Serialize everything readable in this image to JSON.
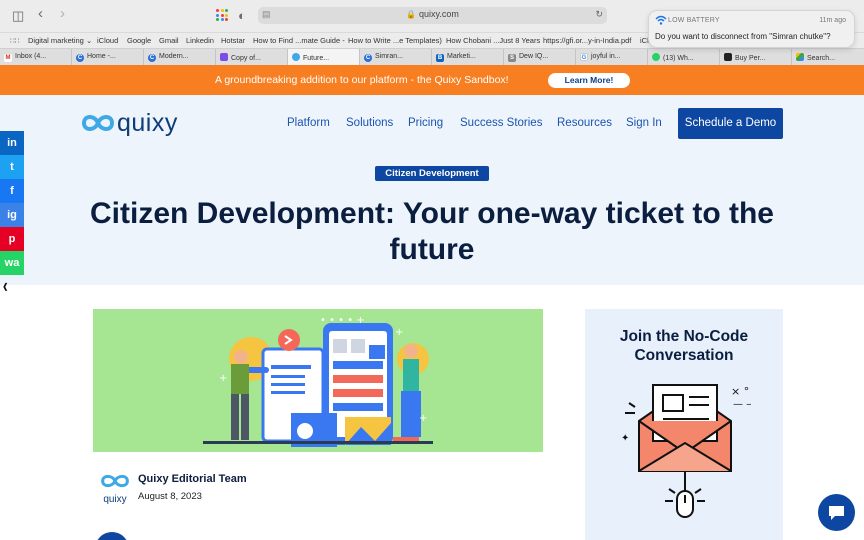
{
  "browser": {
    "url": "quixy.com",
    "bookmarks": [
      "Digital marketing ⌄",
      "iCloud",
      "Google",
      "Gmail",
      "Linkedin",
      "Hotstar",
      "How to Find ...mate Guide -",
      "How to Write ...e Templates)",
      "How Chobani ...Just 8 Years",
      "https://gfi.or...y-in-India.pdf",
      "iCl"
    ],
    "tabs": [
      "Inbox (4...",
      "Home -...",
      "Modern...",
      "Copy of...",
      "Future...",
      "Simran...",
      "Marketi...",
      "Dew IQ...",
      "joyful in...",
      "(13) Wh...",
      "Buy Per...",
      "Search..."
    ]
  },
  "notification": {
    "title": "LOW BATTERY",
    "time": "11m ago",
    "message": "Do you want to disconnect from \"Simran chutke\"?"
  },
  "banner": {
    "text": "A groundbreaking addition to our platform - the Quixy Sandbox!",
    "button": "Learn More!"
  },
  "nav": {
    "logo": "quixy",
    "items": [
      "Platform",
      "Solutions",
      "Pricing",
      "Success Stories",
      "Resources",
      "Sign In"
    ],
    "cta": "Schedule a Demo"
  },
  "hero": {
    "tag": "Citizen Development",
    "title": "Citizen Development: Your one-way ticket to the future"
  },
  "social": [
    "in",
    "t",
    "f",
    "ig",
    "p",
    "wa"
  ],
  "author": {
    "logo_text": "quixy",
    "name": "Quixy Editorial Team",
    "date": "August 8, 2023"
  },
  "sidebar_card": {
    "title": "Join the No-Code Conversation"
  },
  "colors": {
    "brand": "#0d47a1",
    "banner": "#f77f22",
    "hero_bg": "#eef4fb",
    "image_bg": "#a6e592"
  }
}
